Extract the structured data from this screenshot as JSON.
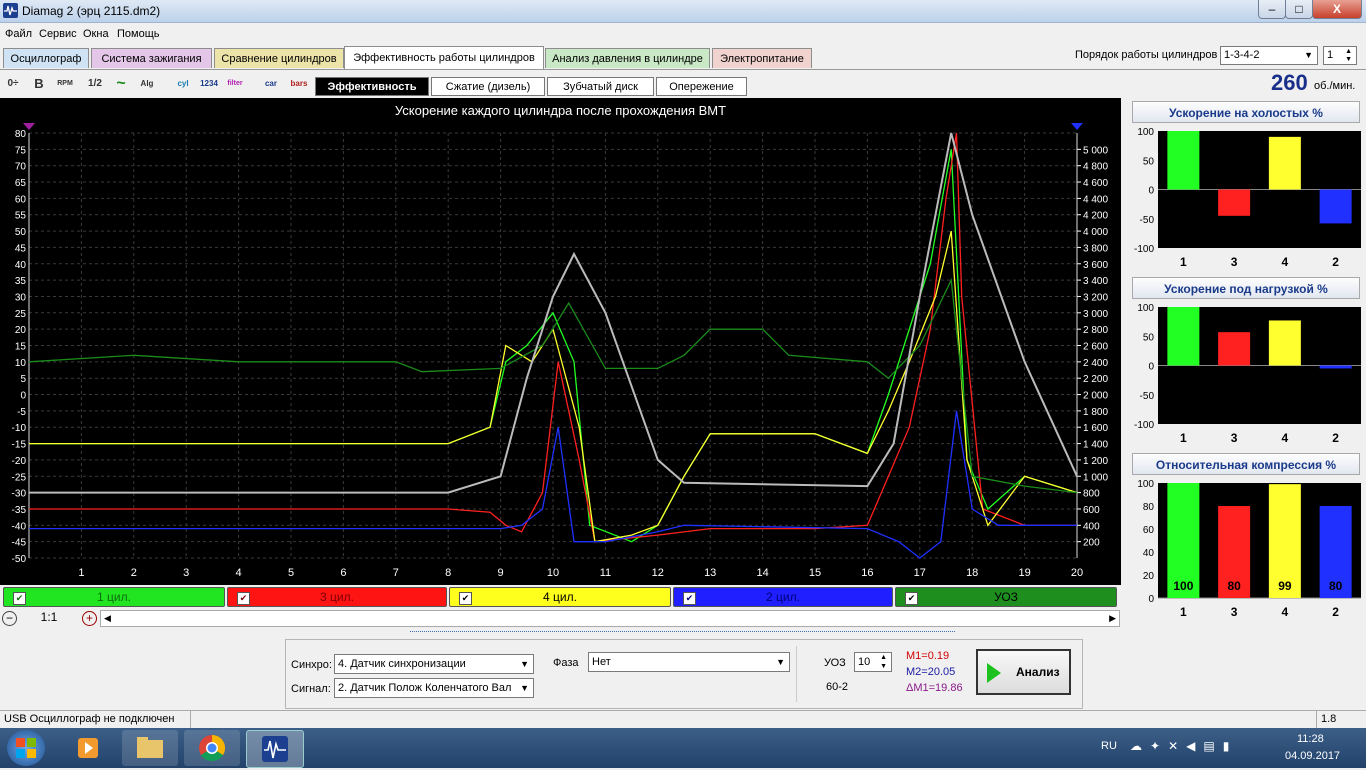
{
  "window": {
    "title": "Diamag 2 (эрц 2115.dm2)",
    "minimize": "–",
    "maximize": "□",
    "close": "X"
  },
  "menu": [
    "Файл",
    "Сервис",
    "Окна",
    "Помощь"
  ],
  "firing_order": {
    "label": "Порядок работы цилиндров",
    "value": "1-3-4-2",
    "cycle": "1"
  },
  "tabs": [
    {
      "label": "Осциллограф",
      "color": "#cfe3f5"
    },
    {
      "label": "Система зажигания",
      "color": "#e4c7e8"
    },
    {
      "label": "Сравнение цилиндров",
      "color": "#ece3a8"
    },
    {
      "label": "Эффективность работы цилиндров",
      "color": "#ffffff"
    },
    {
      "label": "Анализ давления в цилиндре",
      "color": "#c9e9c6"
    },
    {
      "label": "Электропитание",
      "color": "#f0d2cf"
    }
  ],
  "subtabs": [
    "Эффективность",
    "Сжатие (дизель)",
    "Зубчатый диск",
    "Опережение"
  ],
  "rpm": {
    "value": "260",
    "unit": "об./мин."
  },
  "toolbar_icons": [
    "0÷",
    "B",
    "RPM",
    "1/2",
    "~",
    "Alg 1/2",
    "cyl",
    "1234",
    "filter",
    "car",
    "bars"
  ],
  "chart_data": {
    "type": "line",
    "title": "Ускорение каждого цилиндра после прохождения ВМТ",
    "x": [
      1,
      2,
      3,
      4,
      5,
      6,
      7,
      8,
      9,
      10,
      11,
      12,
      13,
      14,
      15,
      16,
      17,
      18,
      19,
      20
    ],
    "xlim": [
      0,
      20
    ],
    "ylim_left": [
      -50,
      80
    ],
    "yticks_left": [
      80,
      75,
      70,
      65,
      60,
      55,
      50,
      45,
      40,
      35,
      30,
      25,
      20,
      15,
      10,
      5,
      0,
      -5,
      -10,
      -15,
      -20,
      -25,
      -30,
      -35,
      -40,
      -45,
      -50
    ],
    "ylim_right": [
      0,
      5200
    ],
    "yticks_right": [
      "5 000",
      "4 800",
      "4 600",
      "4 400",
      "4 200",
      "4 000",
      "3 800",
      "3 600",
      "3 400",
      "3 200",
      "3 000",
      "2 800",
      "2 600",
      "2 400",
      "2 200",
      "2 000",
      "1 800",
      "1 600",
      "1 400",
      "1 200",
      "1 000",
      "800",
      "600",
      "400",
      "200"
    ],
    "grid": true,
    "series": [
      {
        "name": "1 цил.",
        "color": "#22ff22",
        "points": [
          [
            0,
            -15
          ],
          [
            8,
            -15
          ],
          [
            8.8,
            -10
          ],
          [
            9.1,
            10
          ],
          [
            9.5,
            15
          ],
          [
            10,
            25
          ],
          [
            10.4,
            10
          ],
          [
            10.7,
            -40
          ],
          [
            11.5,
            -45
          ],
          [
            12,
            -40
          ],
          [
            12.5,
            -25
          ],
          [
            13,
            -12
          ],
          [
            15,
            -12
          ],
          [
            16,
            -18
          ],
          [
            16.4,
            0
          ],
          [
            16.7,
            15
          ],
          [
            17.2,
            40
          ],
          [
            17.6,
            75
          ],
          [
            17.9,
            -20
          ],
          [
            18.3,
            -35
          ],
          [
            19,
            -25
          ],
          [
            20,
            -30
          ]
        ]
      },
      {
        "name": "3 цил.",
        "color": "#ff2020",
        "points": [
          [
            0,
            -35
          ],
          [
            8,
            -35
          ],
          [
            8.8,
            -36
          ],
          [
            9.1,
            -40
          ],
          [
            9.4,
            -42
          ],
          [
            9.8,
            -30
          ],
          [
            10.1,
            10
          ],
          [
            10.5,
            -20
          ],
          [
            10.8,
            -45
          ],
          [
            12,
            -43
          ],
          [
            13,
            -41
          ],
          [
            15,
            -41
          ],
          [
            16,
            -40
          ],
          [
            16.4,
            -25
          ],
          [
            16.8,
            -10
          ],
          [
            17.2,
            20
          ],
          [
            17.5,
            60
          ],
          [
            17.7,
            80
          ],
          [
            17.8,
            30
          ],
          [
            18.2,
            -35
          ],
          [
            19,
            -40
          ],
          [
            20,
            -40
          ]
        ]
      },
      {
        "name": "4 цил.",
        "color": "#ffff30",
        "points": [
          [
            0,
            -15
          ],
          [
            8,
            -15
          ],
          [
            8.8,
            -10
          ],
          [
            9.1,
            15
          ],
          [
            9.6,
            10
          ],
          [
            10,
            20
          ],
          [
            10.5,
            -10
          ],
          [
            10.8,
            -45
          ],
          [
            11.5,
            -43
          ],
          [
            12,
            -40
          ],
          [
            12.5,
            -25
          ],
          [
            13,
            -12
          ],
          [
            15,
            -12
          ],
          [
            16,
            -18
          ],
          [
            16.4,
            -5
          ],
          [
            16.8,
            10
          ],
          [
            17.3,
            30
          ],
          [
            17.6,
            50
          ],
          [
            17.9,
            -20
          ],
          [
            18.3,
            -40
          ],
          [
            19,
            -25
          ],
          [
            20,
            -30
          ]
        ]
      },
      {
        "name": "2 цил.",
        "color": "#2030ff",
        "points": [
          [
            0,
            -41
          ],
          [
            8,
            -41
          ],
          [
            9,
            -41
          ],
          [
            9.4,
            -40
          ],
          [
            9.8,
            -35
          ],
          [
            10.1,
            -10
          ],
          [
            10.4,
            -45
          ],
          [
            11,
            -45
          ],
          [
            12,
            -42
          ],
          [
            12.5,
            -40
          ],
          [
            16,
            -41
          ],
          [
            16.6,
            -45
          ],
          [
            17,
            -50
          ],
          [
            17.4,
            -45
          ],
          [
            17.7,
            -5
          ],
          [
            18,
            -35
          ],
          [
            18.5,
            -40
          ],
          [
            20,
            -40
          ]
        ]
      },
      {
        "name": "УОЗ",
        "color": "#1a8c1a",
        "points": [
          [
            0,
            10
          ],
          [
            2,
            12
          ],
          [
            4,
            10
          ],
          [
            7,
            10
          ],
          [
            7.5,
            7
          ],
          [
            9,
            8
          ],
          [
            9.8,
            15
          ],
          [
            10.3,
            28
          ],
          [
            11,
            8
          ],
          [
            12,
            8
          ],
          [
            12.5,
            12
          ],
          [
            13,
            20
          ],
          [
            14,
            20
          ],
          [
            14.5,
            12
          ],
          [
            16,
            10
          ],
          [
            16.4,
            5
          ],
          [
            17,
            15
          ],
          [
            17.6,
            35
          ],
          [
            18,
            -25
          ],
          [
            19,
            -28
          ],
          [
            20,
            -30
          ]
        ]
      },
      {
        "name": "RPM",
        "color": "#bbbbbb",
        "points": [
          [
            0,
            -30
          ],
          [
            8,
            -30
          ],
          [
            9,
            -25
          ],
          [
            9.5,
            5
          ],
          [
            10,
            30
          ],
          [
            10.4,
            43
          ],
          [
            11,
            25
          ],
          [
            12,
            -20
          ],
          [
            12.5,
            -27
          ],
          [
            16,
            -28
          ],
          [
            16.5,
            -15
          ],
          [
            17,
            30
          ],
          [
            17.6,
            80
          ],
          [
            18,
            55
          ],
          [
            19,
            10
          ],
          [
            20,
            -25
          ]
        ]
      }
    ]
  },
  "legend": [
    {
      "label": "1 цил.",
      "bg": "#21e521",
      "fg": "#0c6e0c"
    },
    {
      "label": "3 цил.",
      "bg": "#ff1414",
      "fg": "#7a0000"
    },
    {
      "label": "4 цил.",
      "bg": "#ffff1e",
      "fg": "#000000"
    },
    {
      "label": "2 цил.",
      "bg": "#1f1fff",
      "fg": "#00007a"
    },
    {
      "label": "УОЗ",
      "bg": "#1e8f1e",
      "fg": "#000000"
    }
  ],
  "zoom": {
    "minus": "−",
    "value": "1:1",
    "plus": "+"
  },
  "side_panels": [
    {
      "title": "Ускорение на холостых %",
      "type": "bar",
      "categories": [
        "1",
        "3",
        "4",
        "2"
      ],
      "values": [
        100,
        -45,
        90,
        -58
      ],
      "ylim": [
        -100,
        100
      ],
      "yticks": [
        "100",
        "50",
        "0",
        "-50",
        "-100"
      ],
      "colors": [
        "#22ff22",
        "#ff2020",
        "#ffff30",
        "#2030ff"
      ],
      "show_values": false
    },
    {
      "title": "Ускорение под нагрузкой %",
      "type": "bar",
      "categories": [
        "1",
        "3",
        "4",
        "2"
      ],
      "values": [
        100,
        57,
        77,
        -5
      ],
      "ylim": [
        -100,
        100
      ],
      "yticks": [
        "100",
        "50",
        "0",
        "-50",
        "-100"
      ],
      "colors": [
        "#22ff22",
        "#ff2020",
        "#ffff30",
        "#2030ff"
      ],
      "show_values": false
    },
    {
      "title": "Относительная компрессия %",
      "type": "bar",
      "categories": [
        "1",
        "3",
        "4",
        "2"
      ],
      "values": [
        100,
        80,
        99,
        80
      ],
      "ylim": [
        0,
        100
      ],
      "yticks": [
        "100",
        "80",
        "60",
        "40",
        "20",
        "0"
      ],
      "colors": [
        "#22ff22",
        "#ff2020",
        "#ffff30",
        "#2030ff"
      ],
      "show_values": true
    }
  ],
  "bottom": {
    "sync_label": "Синхро:",
    "sync_value": "4.  Датчик синхронизации",
    "signal_label": "Сигнал:",
    "signal_value": "2.  Датчик Полож Коленчатого Вал",
    "phase_label": "Фаза",
    "phase_value": "Нет",
    "uoz_label": "УОЗ",
    "uoz_value": "10",
    "teeth": "60-2",
    "m1": "M1=0.19",
    "m2": "M2=20.05",
    "dm": "ΔM1=19.86",
    "analysis": "Анализ"
  },
  "status": {
    "text": "USB Осциллограф не подключен",
    "version": "1.8"
  },
  "taskbar": {
    "lang": "RU",
    "time": "11:28",
    "date": "04.09.2017"
  }
}
